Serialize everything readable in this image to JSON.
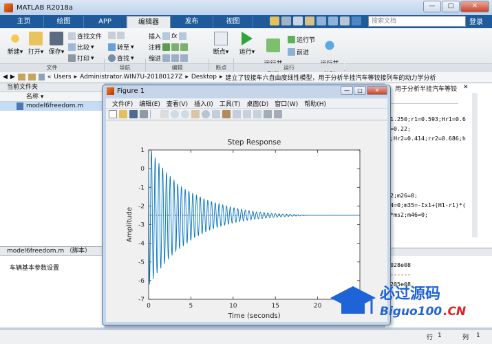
{
  "window": {
    "title": "MATLAB R2018a",
    "min": "—",
    "max": "□",
    "close": "✕"
  },
  "tabs": [
    "主页",
    "绘图",
    "APP",
    "编辑器",
    "发布",
    "视图"
  ],
  "active_tab": 3,
  "search_placeholder": "搜索文档",
  "login": "登录",
  "ribbon": {
    "file": {
      "new": "新建",
      "open": "打开",
      "save": "保存",
      "find_files": "查找文件",
      "compare": "比较",
      "print": "打印",
      "group": "文件"
    },
    "nav": {
      "goto": "转至",
      "find": "查找",
      "group": "导航"
    },
    "edit": {
      "insert": "插入",
      "fx": "fx",
      "comment": "注释",
      "indent": "缩进",
      "group": "编辑"
    },
    "breakpoints": {
      "label": "断点",
      "group": "断点"
    },
    "run": {
      "run": "运行",
      "run_advance": "运行并\n前进",
      "run_section": "运行节",
      "advance": "前进",
      "run_time": "运行并\n计时",
      "group": "运行"
    }
  },
  "address": {
    "parts": [
      "«",
      "Users",
      "▸",
      "Administrator.WIN7U-20180127Z",
      "▸",
      "Desktop",
      "▸",
      "建立了铰接车六自由度线性模型，用于分析半挂汽车等铰接列车的动力学分析"
    ]
  },
  "left_panel": {
    "title": "当前文件夹",
    "col_name": "名称",
    "file": "model6freedom.m",
    "detail_title": "model6freedom.m （脚本）",
    "detail_text": "车辆基本参数设置"
  },
  "right_panel": {
    "header": "，用于分析半挂汽车等铰",
    "code_lines": [
      "1.250;r1=0.593;Hr1=0.6",
      "=0.22;",
      ";Hr2=0.414;rr2=0.686;h",
      "2;m26=0;",
      "4=0;m35=-Ix1+(H1-r1)*(",
      "*ms2;m46=0;"
    ],
    "output_lines": [
      "028e08",
      "------",
      "205e08"
    ]
  },
  "status": {
    "row_label": "行",
    "row": "1",
    "col_label": "列",
    "col": "1"
  },
  "figure": {
    "title": "Figure 1",
    "menus": [
      "文件(F)",
      "编辑(E)",
      "查看(V)",
      "插入(I)",
      "工具(T)",
      "桌面(D)",
      "窗口(W)",
      "帮助(H)"
    ]
  },
  "watermark": {
    "main": "必过源码",
    "sub": "Biguo100",
    "tld": ".CN"
  },
  "colors": {
    "accent": "#1f5b9a",
    "plot_line": "#0072bd",
    "watermark": "#1e64d8"
  },
  "chart_data": {
    "type": "line",
    "title": "Step Response",
    "xlabel": "Time (seconds)",
    "ylabel": "Amplitude",
    "xlim": [
      0,
      25
    ],
    "ylim": [
      -7,
      1
    ],
    "xticks": [
      0,
      5,
      10,
      15,
      20,
      25
    ],
    "yticks": [
      1,
      0,
      -1,
      -2,
      -3,
      -4,
      -5,
      -6,
      -7
    ],
    "steady_state": -2.5,
    "series": [
      {
        "x": [
          0,
          0.1,
          0.33,
          0.55,
          0.77,
          1.0,
          1.22,
          1.44,
          1.66,
          1.88,
          2.11,
          2.33,
          2.55,
          2.77,
          3.0,
          3.22,
          3.44,
          3.66,
          3.88,
          4.11,
          4.33,
          4.55,
          4.77,
          5.0,
          5.22,
          5.44,
          5.66,
          5.88,
          6.11,
          6.33,
          6.55,
          6.77,
          7.0,
          7.22,
          7.44,
          7.66,
          7.88,
          8.11,
          8.33,
          8.55,
          8.77,
          9.0,
          9.22,
          9.44,
          9.66,
          9.88,
          10.11,
          10.33,
          10.55,
          10.77,
          11.0,
          11.22,
          11.44,
          11.66,
          11.88,
          12.11,
          12.33,
          12.55,
          12.77,
          13.0,
          13.22,
          13.44,
          13.66,
          13.88,
          14.11,
          14.33,
          14.55,
          14.77,
          15.0,
          15.22,
          15.44,
          15.66,
          15.88,
          16.11,
          16.33,
          16.55,
          16.77,
          17.0,
          17.22,
          17.44,
          17.66,
          17.88,
          18.11,
          18.33,
          18.55,
          18.77,
          19.0,
          25.0
        ],
        "y": [
          0,
          -6.2,
          1.0,
          -5.9,
          0.6,
          -5.6,
          0.3,
          -5.35,
          0.05,
          -5.1,
          -0.2,
          -4.85,
          -0.4,
          -4.65,
          -0.6,
          -4.45,
          -0.8,
          -4.3,
          -0.95,
          -4.15,
          -1.1,
          -4.0,
          -1.2,
          -3.85,
          -1.3,
          -3.7,
          -1.4,
          -3.6,
          -1.5,
          -3.5,
          -1.6,
          -3.4,
          -1.68,
          -3.3,
          -1.75,
          -3.22,
          -1.82,
          -3.15,
          -1.88,
          -3.08,
          -1.94,
          -3.02,
          -2.0,
          -2.97,
          -2.05,
          -2.92,
          -2.1,
          -2.87,
          -2.14,
          -2.83,
          -2.18,
          -2.8,
          -2.22,
          -2.77,
          -2.25,
          -2.74,
          -2.28,
          -2.71,
          -2.31,
          -2.69,
          -2.33,
          -2.67,
          -2.35,
          -2.65,
          -2.37,
          -2.63,
          -2.39,
          -2.61,
          -2.41,
          -2.6,
          -2.42,
          -2.58,
          -2.43,
          -2.57,
          -2.44,
          -2.56,
          -2.45,
          -2.55,
          -2.46,
          -2.54,
          -2.47,
          -2.53,
          -2.48,
          -2.52,
          -2.49,
          -2.51,
          -2.5,
          -2.5
        ]
      }
    ]
  }
}
